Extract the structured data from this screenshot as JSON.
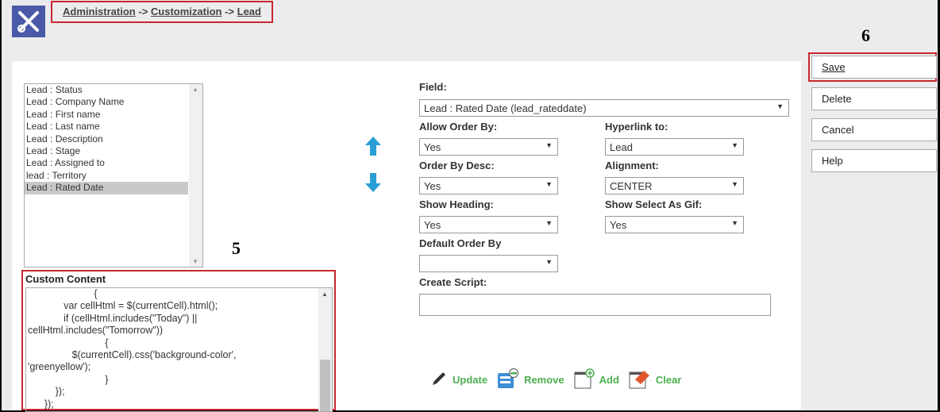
{
  "breadcrumb": {
    "items": [
      "Administration",
      "Customization",
      "Lead"
    ],
    "separator": "->"
  },
  "fields_list": {
    "items": [
      "Lead : Status",
      "Lead : Company Name",
      "Lead : First name",
      "Lead : Last name",
      "Lead : Description",
      "Lead : Stage",
      "Lead : Assigned to",
      "lead : Territory",
      "Lead : Rated Date"
    ],
    "selected": "Lead : Rated Date"
  },
  "annotations": {
    "five": "5",
    "six": "6"
  },
  "custom_content": {
    "label": "Custom Content",
    "code": "                        {\n             var cellHtml = $(currentCell).html();\n             if (cellHtml.includes(\"Today\") ||\ncellHtml.includes(\"Tomorrow\"))\n                            {\n                $(currentCell).css('background-color',\n'greenyellow');\n                            }\n          });\n      });"
  },
  "form": {
    "field": {
      "label": "Field:",
      "value": "Lead : Rated Date (lead_rateddate)"
    },
    "allow_order_by": {
      "label": "Allow Order By:",
      "value": "Yes"
    },
    "hyperlink_to": {
      "label": "Hyperlink to:",
      "value": "Lead"
    },
    "order_by_desc": {
      "label": "Order By Desc:",
      "value": "Yes"
    },
    "alignment": {
      "label": "Alignment:",
      "value": "CENTER"
    },
    "show_heading": {
      "label": "Show Heading:",
      "value": "Yes"
    },
    "show_select_as_gif": {
      "label": "Show Select As Gif:",
      "value": "Yes"
    },
    "default_order_by": {
      "label": "Default Order By",
      "value": ""
    },
    "create_script": {
      "label": "Create Script:",
      "value": ""
    }
  },
  "actions": {
    "update": "Update",
    "remove": "Remove",
    "add": "Add",
    "clear": "Clear"
  },
  "buttons": {
    "save": "Save",
    "delete": "Delete",
    "cancel": "Cancel",
    "help": "Help"
  },
  "colors": {
    "accent": "#2a9fd6",
    "highlight": "#c8282f",
    "action": "#4caf50",
    "logo": "#4a5aa8"
  }
}
